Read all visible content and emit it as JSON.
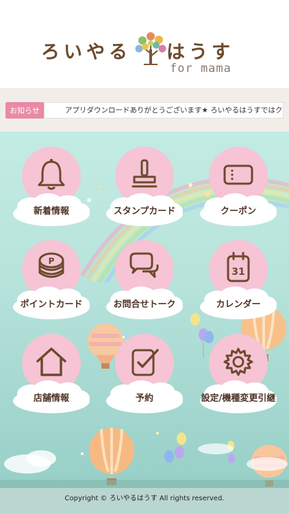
{
  "header": {
    "logo_left": "ろいやる",
    "logo_right": "はうす",
    "logo_sub": "for mama"
  },
  "news": {
    "label": "お知らせ",
    "text": "アプリダウンロードありがとうございます★ ろいやるはうすではクー"
  },
  "menu": [
    {
      "label": "新着情報",
      "icon": "bell-icon"
    },
    {
      "label": "スタンプカード",
      "icon": "stamp-icon"
    },
    {
      "label": "クーポン",
      "icon": "coupon-icon"
    },
    {
      "label": "ポイントカード",
      "icon": "points-coin-icon"
    },
    {
      "label": "お問合せトーク",
      "icon": "chat-bubbles-icon"
    },
    {
      "label": "カレンダー",
      "icon": "calendar-icon"
    },
    {
      "label": "店舗情報",
      "icon": "home-icon"
    },
    {
      "label": "予約",
      "icon": "reservation-check-icon"
    },
    {
      "label": "設定/機種変更引継",
      "icon": "settings-gear-icon"
    }
  ],
  "calendar_day": "31",
  "points_symbol": "P",
  "footer": {
    "copyright": "Copyright © ろいやるはうす All rights reserved."
  },
  "colors": {
    "accent_pink": "#f6c4d4",
    "label_pink": "#e98aa6",
    "brown": "#6b4a2e",
    "sky": "#c2ebe3"
  }
}
